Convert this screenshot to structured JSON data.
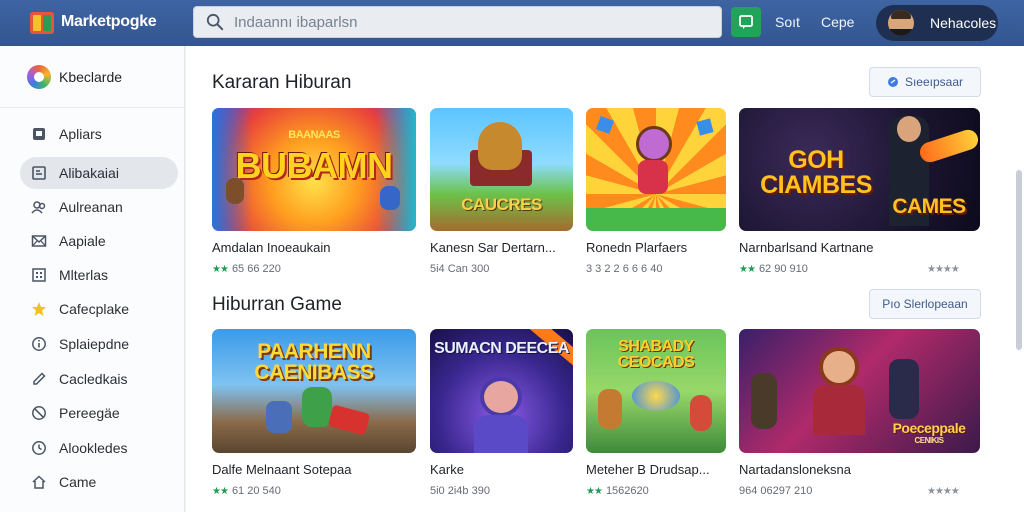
{
  "app": {
    "name": "Marketpogke"
  },
  "search": {
    "placeholder": "Indaannı ibaparlsn"
  },
  "topbar": {
    "link1": "Soıt",
    "link2": "Cepe",
    "profile_name": "Nehacoles"
  },
  "sidebar": {
    "title": "Kbeclarde",
    "items": [
      {
        "label": "Apliars",
        "icon": "tag-icon"
      },
      {
        "label": "Alibakaiai",
        "icon": "list-icon"
      },
      {
        "label": "Aulreanan",
        "icon": "people-icon"
      },
      {
        "label": "Aapiale",
        "icon": "mail-icon"
      },
      {
        "label": "Mlterlas",
        "icon": "grid-icon"
      },
      {
        "label": "Cafecplake",
        "icon": "star-icon"
      },
      {
        "label": "Splaiepdne",
        "icon": "info-icon"
      },
      {
        "label": "Cacledkais",
        "icon": "pencil-icon"
      },
      {
        "label": "Pereegäe",
        "icon": "no-icon"
      },
      {
        "label": "Alookledes",
        "icon": "clock-icon"
      },
      {
        "label": "Came",
        "icon": "home-icon"
      }
    ]
  },
  "sections": [
    {
      "title": "Kararan Hiburan",
      "see_all": "Sıeeıpsaar",
      "cards": [
        {
          "title": "Amdalan Inoeaukain",
          "meta": "65 66 220",
          "rating": "green",
          "thumb_text": "BUBAMN",
          "thumb_sub": "BAANAAS"
        },
        {
          "title": "Kanesn Sar Dertarn...",
          "meta": "5i4 Can 300",
          "rating": "none",
          "thumb_text": "CAUCRES",
          "thumb_sub": ""
        },
        {
          "title": "Ronedn Plarfaers",
          "meta": "3 3 2 2 6 6 6 40",
          "rating": "none",
          "thumb_text": "",
          "thumb_sub": ""
        },
        {
          "title": "Narnbarlsand Kartnane",
          "meta": "62 90 910",
          "rating": "green",
          "thumb_text": "GOH CIAMBES",
          "thumb_sub": "CAMES"
        }
      ]
    },
    {
      "title": "Hiburran Game",
      "see_all": "Pıo Slerlopeaan",
      "cards": [
        {
          "title": "Dalfe Melnaant Sotepaa",
          "meta": "61 20 540",
          "rating": "green",
          "thumb_text": "PAARHENN CAENIBASS",
          "thumb_sub": ""
        },
        {
          "title": "Karke",
          "meta": "5i0 2i4b 390",
          "rating": "none",
          "thumb_text": "SUMACN DEECEA",
          "thumb_sub": ""
        },
        {
          "title": "Meteher B Drudsap...",
          "meta": "1562620",
          "rating": "green",
          "thumb_text": "SHABADY CEOCADS",
          "thumb_sub": ""
        },
        {
          "title": "Nartadansloneksna",
          "meta": "964 06297 210",
          "rating": "grey",
          "thumb_text": "Poeceppale",
          "thumb_sub": "CENIKIS"
        }
      ]
    }
  ],
  "colors": {
    "topbar": "#3a5e9c",
    "accent_green": "#21a35a",
    "profile_bg": "#1e2f52"
  }
}
